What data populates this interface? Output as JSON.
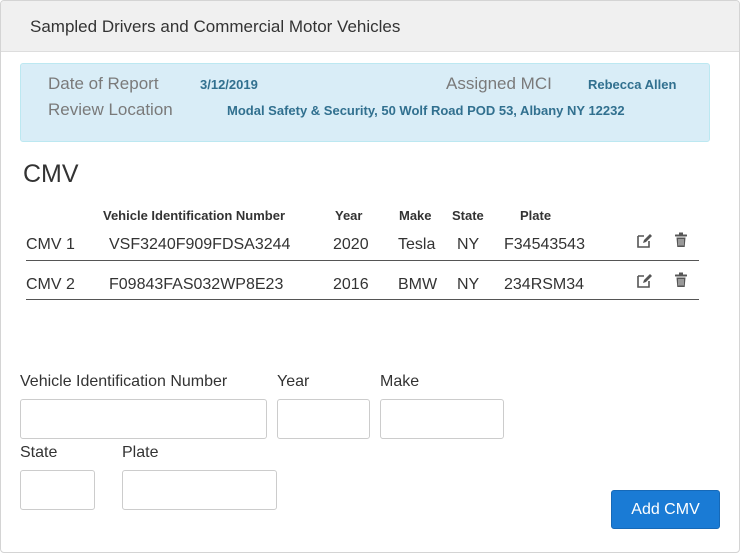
{
  "panel": {
    "title": "Sampled Drivers and Commercial Motor Vehicles"
  },
  "report_info": {
    "date_label": "Date of Report",
    "date_value": "3/12/2019",
    "location_label": "Review Location",
    "location_value": "Modal Safety & Security, 50 Wolf Road POD 53, Albany NY 12232",
    "mci_label": "Assigned MCI",
    "mci_value": "Rebecca Allen"
  },
  "cmv_section": {
    "title": "CMV",
    "columns": {
      "vin": "Vehicle Identification Number",
      "year": "Year",
      "make": "Make",
      "state": "State",
      "plate": "Plate"
    },
    "rows": [
      {
        "label": "CMV 1",
        "vin": "VSF3240F909FDSA3244",
        "year": "2020",
        "make": "Tesla",
        "state": "NY",
        "plate": "F34543543"
      },
      {
        "label": "CMV 2",
        "vin": "F09843FAS032WP8E23",
        "year": "2016",
        "make": "BMW",
        "state": "NY",
        "plate": "234RSM34"
      }
    ]
  },
  "form": {
    "vin_label": "Vehicle Identification Number",
    "vin_value": "",
    "year_label": "Year",
    "year_value": "",
    "make_label": "Make",
    "make_value": "",
    "state_label": "State",
    "state_value": "",
    "plate_label": "Plate",
    "plate_value": "",
    "add_button_label": "Add CMV"
  },
  "icons": {
    "edit": "edit-icon",
    "delete": "trash-icon"
  },
  "colors": {
    "info_background": "#d9edf7",
    "info_value_text": "#31708f",
    "primary_button": "#1a7bd5"
  }
}
